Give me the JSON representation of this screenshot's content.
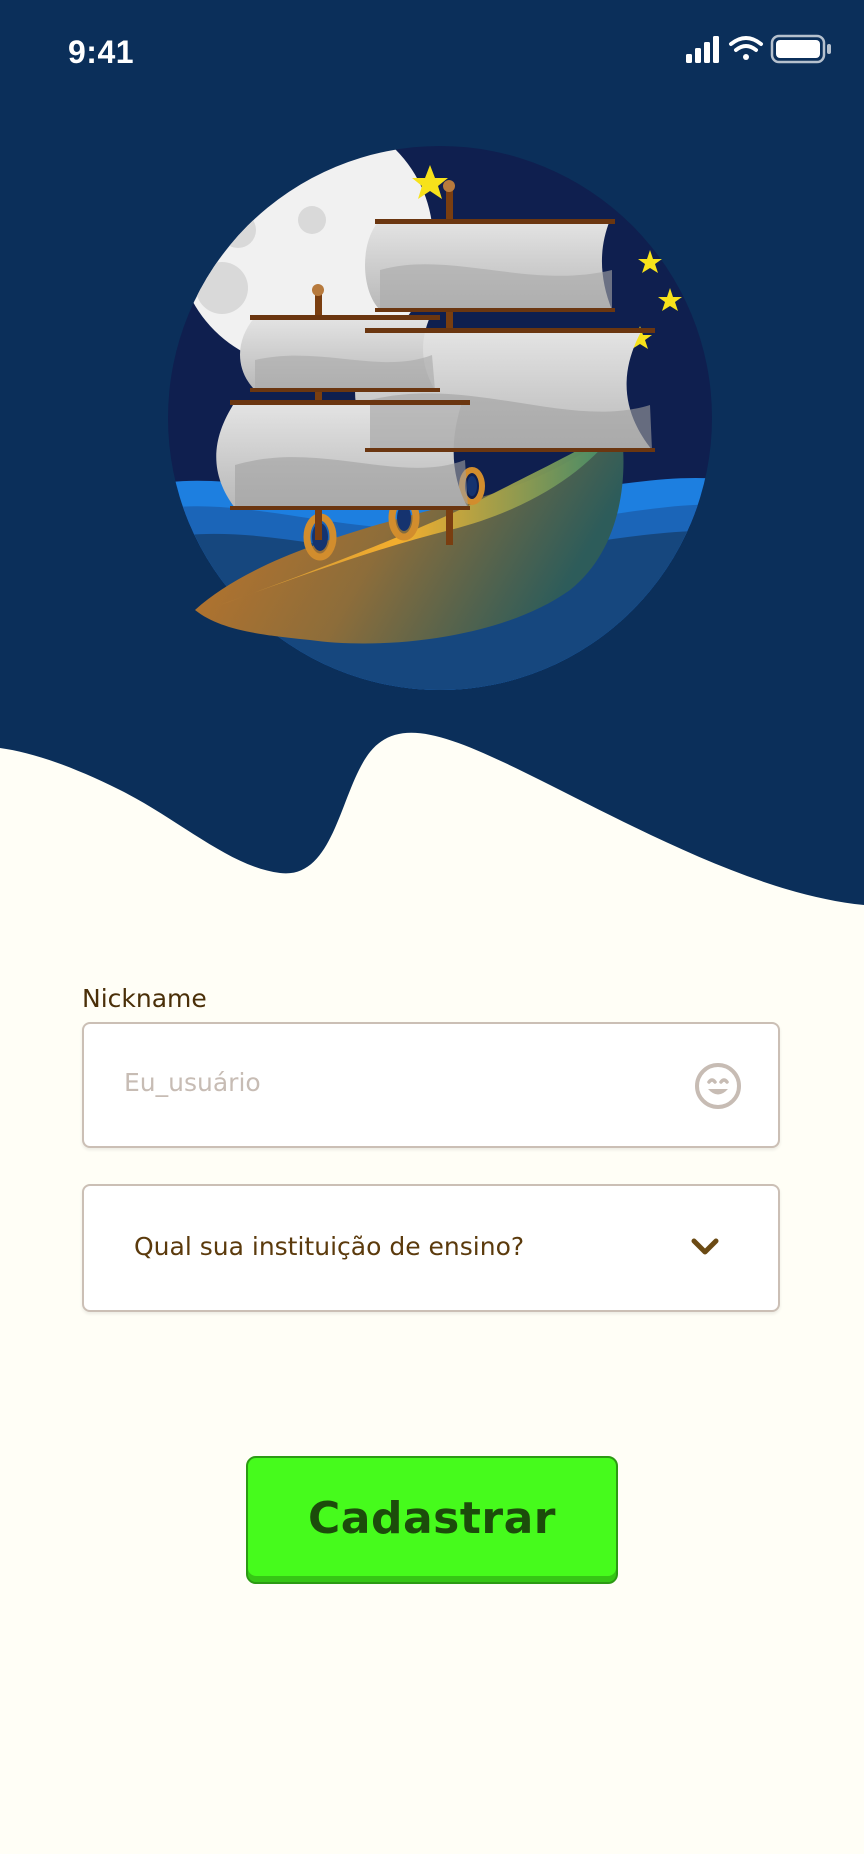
{
  "status_bar": {
    "time": "9:41"
  },
  "form": {
    "nickname_label": "Nickname",
    "nickname_placeholder": "Eu_usuário",
    "institution_select": "Qual sua instituição de ensino?",
    "submit_label": "Cadastrar"
  },
  "colors": {
    "header_background": "#0b2f5a",
    "page_background": "#fffef6",
    "submit_button": "#46fb1c",
    "submit_text": "#1c4c0b",
    "label_text": "#4a2f08"
  },
  "icons": {
    "signal": "cellular-signal-icon",
    "wifi": "wifi-icon",
    "battery": "battery-icon",
    "nickname_field": "smiley-face-icon",
    "select": "chevron-down-icon"
  }
}
